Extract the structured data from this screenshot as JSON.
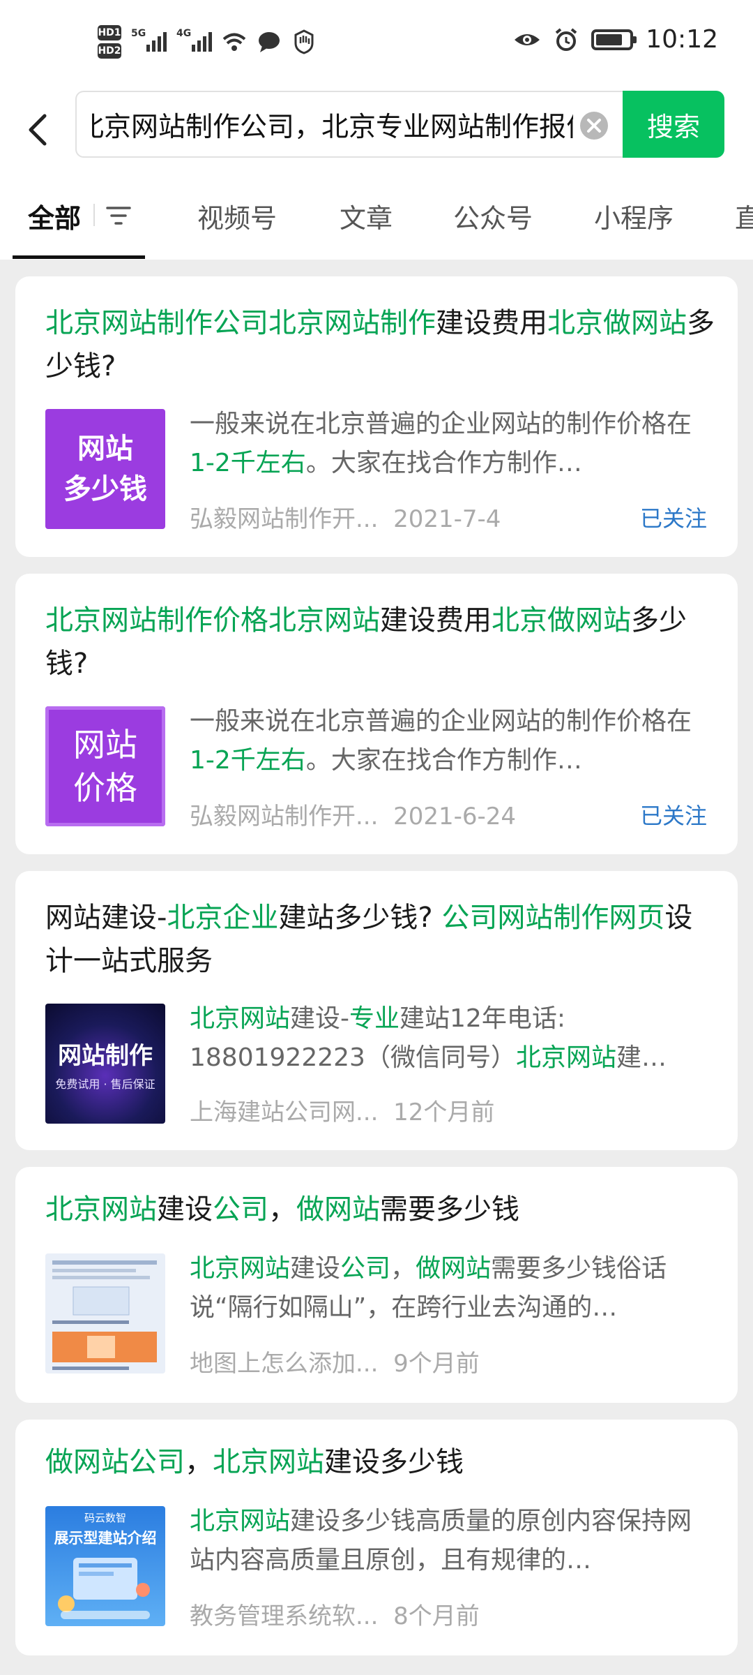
{
  "status_bar": {
    "hd1": "HD1",
    "hd2": "HD2",
    "net1": "5G",
    "net2": "4G",
    "time": "10:12"
  },
  "search": {
    "query": "北京网站制作公司，北京专业网站制作报价",
    "button": "搜索"
  },
  "tabs": [
    "全部",
    "视频号",
    "文章",
    "公众号",
    "小程序",
    "直"
  ],
  "colors": {
    "accent": "#07c160",
    "highlight": "#07a454",
    "follow": "#2c78c8"
  },
  "results": [
    {
      "title_parts": [
        {
          "t": "北京网站制作公司北京网站制作",
          "hl": true
        },
        {
          "t": "建设费用",
          "hl": false
        },
        {
          "t": "北京做网站",
          "hl": true
        },
        {
          "t": "多少钱?",
          "hl": false
        }
      ],
      "thumb_lines": [
        "网站",
        "多少钱"
      ],
      "snippet_parts": [
        {
          "t": "一般来说在北京普遍的企业网站的制作价格在",
          "hl": false
        },
        {
          "t": "1-2千左右",
          "hl": true
        },
        {
          "t": "。大家在找合作方制作…",
          "hl": false
        }
      ],
      "source": "弘毅网站制作开...",
      "date": "2021-7-4",
      "follow": "已关注"
    },
    {
      "title_parts": [
        {
          "t": "北京网站制作价格北京网站",
          "hl": true
        },
        {
          "t": "建设费用",
          "hl": false
        },
        {
          "t": "北京做网站",
          "hl": true
        },
        {
          "t": "多少钱?",
          "hl": false
        }
      ],
      "thumb_lines": [
        "网站",
        "价格"
      ],
      "snippet_parts": [
        {
          "t": "一般来说在北京普遍的企业网站的制作价格在",
          "hl": false
        },
        {
          "t": "1-2千左右",
          "hl": true
        },
        {
          "t": "。大家在找合作方制作…",
          "hl": false
        }
      ],
      "source": "弘毅网站制作开...",
      "date": "2021-6-24",
      "follow": "已关注"
    },
    {
      "title_parts": [
        {
          "t": "网站建设-",
          "hl": false
        },
        {
          "t": "北京企业",
          "hl": true
        },
        {
          "t": "建站多少钱? ",
          "hl": false
        },
        {
          "t": "公司网站制作网页",
          "hl": true
        },
        {
          "t": "设计一站式服务",
          "hl": false
        }
      ],
      "thumb_lines": [
        "网站制作",
        "免费试用 · 售后保证"
      ],
      "snippet_parts": [
        {
          "t": "北京网站",
          "hl": true
        },
        {
          "t": "建设-",
          "hl": false
        },
        {
          "t": "专业",
          "hl": true
        },
        {
          "t": "建站12年电话: 18801922223（微信同号）",
          "hl": false
        },
        {
          "t": "北京网站",
          "hl": true
        },
        {
          "t": "建…",
          "hl": false
        }
      ],
      "source": "上海建站公司网...",
      "date": "12个月前",
      "follow": ""
    },
    {
      "title_parts": [
        {
          "t": "北京网站",
          "hl": true
        },
        {
          "t": "建设",
          "hl": false
        },
        {
          "t": "公司",
          "hl": true
        },
        {
          "t": "，",
          "hl": false
        },
        {
          "t": "做网站",
          "hl": true
        },
        {
          "t": "需要多少钱",
          "hl": false
        }
      ],
      "thumb_lines": [],
      "snippet_parts": [
        {
          "t": "北京网站",
          "hl": true
        },
        {
          "t": "建设",
          "hl": false
        },
        {
          "t": "公司",
          "hl": true
        },
        {
          "t": "，",
          "hl": false
        },
        {
          "t": "做网站",
          "hl": true
        },
        {
          "t": "需要多少钱俗话说“隔行如隔山”，在跨行业去沟通的…",
          "hl": false
        }
      ],
      "source": "地图上怎么添加...",
      "date": "9个月前",
      "follow": ""
    },
    {
      "title_parts": [
        {
          "t": "做网站公司",
          "hl": true
        },
        {
          "t": "，",
          "hl": false
        },
        {
          "t": "北京网站",
          "hl": true
        },
        {
          "t": "建设多少钱",
          "hl": false
        }
      ],
      "thumb_lines": [
        "码云数智",
        "展示型建站介绍"
      ],
      "snippet_parts": [
        {
          "t": "北京网站",
          "hl": true
        },
        {
          "t": "建设多少钱高质量的原创内容保持网站内容高质量且原创，且有规律的…",
          "hl": false
        }
      ],
      "source": "教务管理系统软...",
      "date": "8个月前",
      "follow": ""
    }
  ]
}
